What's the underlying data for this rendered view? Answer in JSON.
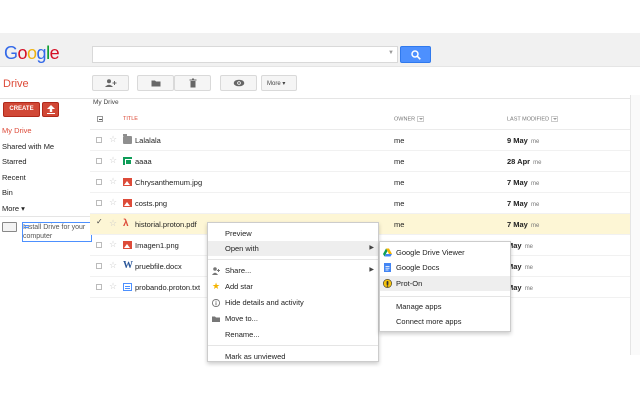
{
  "header": {
    "logo": [
      "G",
      "o",
      "o",
      "g",
      "l",
      "e"
    ],
    "search": {
      "value": "",
      "placeholder": ""
    }
  },
  "drivebar": {
    "title": "Drive",
    "buttons": {
      "share_icon": "add-person-icon",
      "folder_icon": "folder-icon",
      "delete_icon": "trash-icon",
      "preview_icon": "eye-icon",
      "more": "More ▾"
    }
  },
  "sidebar": {
    "create": "CREATE",
    "items": [
      {
        "label": "My Drive",
        "active": true
      },
      {
        "label": "Shared with Me"
      },
      {
        "label": "Starred"
      },
      {
        "label": "Recent"
      },
      {
        "label": "Bin"
      },
      {
        "label": "More ▾"
      }
    ],
    "install": "Install Drive for your computer"
  },
  "main": {
    "breadcrumb": "My Drive",
    "columns": {
      "title": "TITLE",
      "owner": "OWNER",
      "modified": "LAST MODIFIED"
    },
    "rows": [
      {
        "name": "Lalalala",
        "type": "folder",
        "owner": "me",
        "date": "9 May",
        "by": "me",
        "selected": false
      },
      {
        "name": "aaaa",
        "type": "sheet",
        "owner": "me",
        "date": "28 Apr",
        "by": "me",
        "selected": false
      },
      {
        "name": "Chrysanthemum.jpg",
        "type": "image",
        "owner": "me",
        "date": "7 May",
        "by": "me",
        "selected": false
      },
      {
        "name": "costs.png",
        "type": "image",
        "owner": "me",
        "date": "7 May",
        "by": "me",
        "selected": false
      },
      {
        "name": "historial.proton.pdf",
        "type": "pdf",
        "owner": "me",
        "date": "7 May",
        "by": "me",
        "selected": true
      },
      {
        "name": "Imagen1.png",
        "type": "image",
        "owner": "",
        "date": "May",
        "by": "me",
        "selected": false
      },
      {
        "name": "pruebfile.docx",
        "type": "word",
        "owner": "",
        "date": "May",
        "by": "me",
        "selected": false
      },
      {
        "name": "probando.proton.txt",
        "type": "txt",
        "owner": "",
        "date": "May",
        "by": "me",
        "selected": false
      }
    ]
  },
  "context_menu": {
    "items": [
      {
        "label": "Preview"
      },
      {
        "label": "Open with",
        "submenu": true,
        "highlighted": true
      },
      {
        "label": "Share...",
        "submenu": true,
        "icon": "share-person-icon"
      },
      {
        "label": "Add star",
        "icon": "star-icon"
      },
      {
        "label": "Hide details and activity",
        "icon": "info-icon"
      },
      {
        "label": "Move to...",
        "icon": "folder-icon"
      },
      {
        "label": "Rename..."
      },
      {
        "label": "Mark as unviewed"
      }
    ]
  },
  "submenu": {
    "items": [
      {
        "label": "Google Drive Viewer",
        "icon": "drive-viewer-icon"
      },
      {
        "label": "Google Docs",
        "icon": "docs-icon"
      },
      {
        "label": "Prot-On",
        "icon": "proton-icon",
        "highlighted": true
      },
      {
        "label": "Manage apps"
      },
      {
        "label": "Connect more apps"
      }
    ]
  },
  "colors": {
    "accent_red": "#dd4b39",
    "search_blue": "#4d90fe",
    "selected_row": "#fdf6d5"
  }
}
